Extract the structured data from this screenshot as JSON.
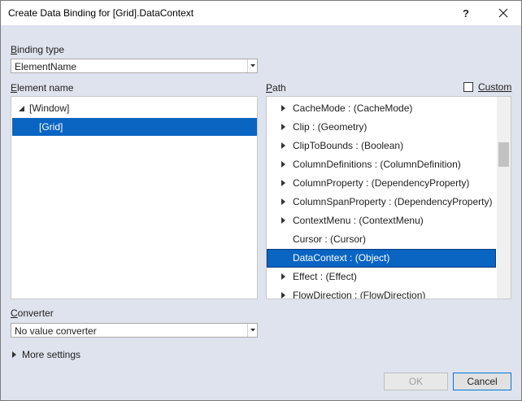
{
  "window": {
    "title": "Create Data Binding for [Grid].DataContext",
    "help_label": "?",
    "close_label": "✕"
  },
  "binding_type": {
    "label_prefix": "B",
    "label_rest": "inding type",
    "value": "ElementName"
  },
  "element_name": {
    "label_prefix": "E",
    "label_rest": "lement name",
    "items": [
      {
        "label": "[Window]"
      },
      {
        "label": "[Grid]"
      }
    ]
  },
  "path": {
    "label_prefix": "P",
    "label_rest": "ath",
    "custom_label": "Custom",
    "items": [
      {
        "label": "CacheMode : (CacheMode)",
        "expandable": true
      },
      {
        "label": "Clip : (Geometry)",
        "expandable": true
      },
      {
        "label": "ClipToBounds : (Boolean)",
        "expandable": true
      },
      {
        "label": "ColumnDefinitions : (ColumnDefinition)",
        "expandable": true
      },
      {
        "label": "ColumnProperty : (DependencyProperty)",
        "expandable": true
      },
      {
        "label": "ColumnSpanProperty : (DependencyProperty)",
        "expandable": true
      },
      {
        "label": "ContextMenu : (ContextMenu)",
        "expandable": true
      },
      {
        "label": "Cursor : (Cursor)",
        "expandable": false
      },
      {
        "label": "DataContext : (Object)",
        "expandable": false
      },
      {
        "label": "Effect : (Effect)",
        "expandable": true
      },
      {
        "label": "FlowDirection : (FlowDirection)",
        "expandable": true
      }
    ]
  },
  "converter": {
    "label_prefix": "C",
    "label_rest": "onverter",
    "value": "No value converter"
  },
  "more_settings": {
    "label": "More settings"
  },
  "buttons": {
    "ok_label": "OK",
    "cancel_label": "Cancel"
  }
}
